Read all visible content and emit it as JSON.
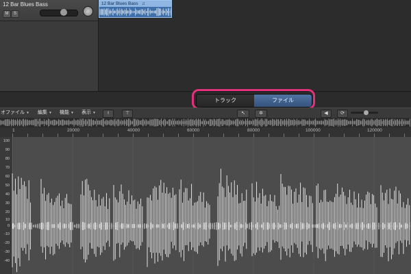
{
  "track": {
    "name": "12 Bar Blues Bass",
    "mute_label": "M",
    "solo_label": "S"
  },
  "region": {
    "label": "12 Bar Blues Bass",
    "loop_icon": "loop-icon"
  },
  "view_switch": {
    "track_label": "トラック",
    "file_label": "ファイル",
    "highlight_color": "#e2327c",
    "active_color": "#3d5d8a"
  },
  "editor_menu": {
    "items": [
      "オファイル",
      "編集",
      "機能",
      "表示"
    ],
    "tools": [
      "split-tool-icon",
      "filter-tool-icon",
      "pointer-tool-icon",
      "gear-tool-icon"
    ]
  },
  "transport_icons": [
    "speaker-icon",
    "cycle-icon",
    "volume-slider-icon"
  ],
  "ruler": {
    "labels": [
      "1",
      "20000",
      "40000",
      "60000",
      "80000",
      "100000",
      "120000"
    ]
  },
  "y_axis": {
    "labels": [
      "100",
      "90",
      "80",
      "70",
      "60",
      "50",
      "40",
      "30",
      "20",
      "10",
      "0",
      "-10",
      "-20",
      "-30",
      "-40"
    ]
  },
  "colors": {
    "waveform": "#ffffff",
    "region_fill": "#3f6fa9",
    "region_header": "#8fb6e3"
  }
}
